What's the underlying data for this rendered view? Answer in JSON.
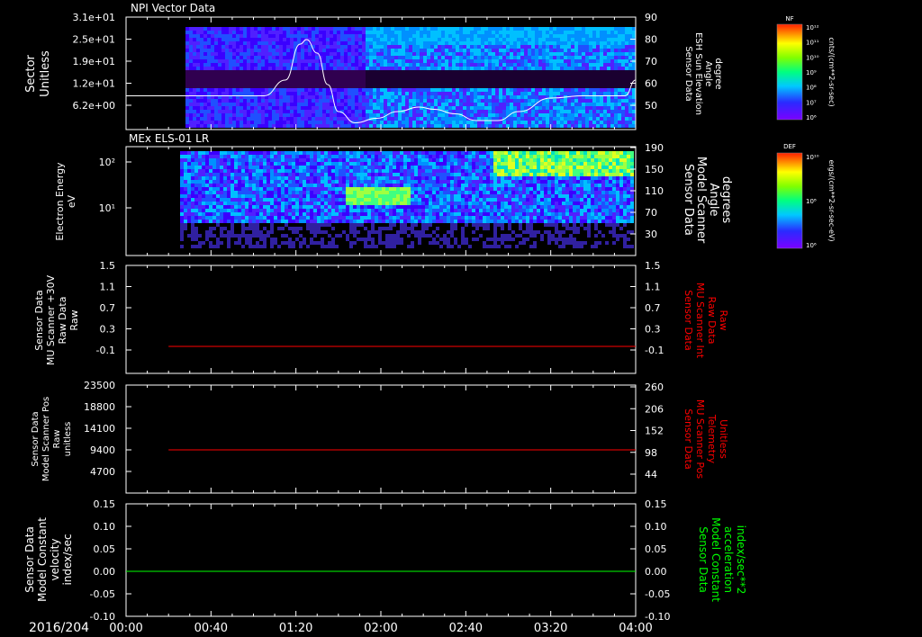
{
  "footer": {
    "date": "2016/204"
  },
  "time_ticks": [
    "00:00",
    "00:40",
    "01:20",
    "02:00",
    "02:40",
    "03:20",
    "04:00"
  ],
  "colorbars": [
    {
      "label": "NF",
      "unit": "cnts/(cm**2-sr-sec)",
      "ticks": [
        "10¹²",
        "10¹¹",
        "10¹⁰",
        "10⁹",
        "10⁸",
        "10⁷",
        "10⁶"
      ]
    },
    {
      "label": "DEF",
      "unit": "ergs/(cm**2-sr-sec-eV)",
      "ticks": [
        "10¹⁰",
        "10⁸",
        "10⁶"
      ]
    }
  ],
  "chart_data": [
    {
      "type": "heatmap",
      "title": "NPI Vector Data",
      "ylabel": [
        "Sector",
        "Unitless"
      ],
      "yticks": [
        "3.1e+01",
        "2.5e+01",
        "1.9e+01",
        "1.2e+01",
        "6.2e+00"
      ],
      "y2label": [
        "Sensor Data",
        "ESH Sun Elevation",
        "Angle",
        "degree"
      ],
      "y2ticks": [
        "90",
        "80",
        "70",
        "60",
        "50"
      ],
      "y2lim": [
        40,
        90
      ],
      "xlim": [
        0,
        240
      ],
      "overlay_series": {
        "name": "ESH Sun Elevation Angle",
        "color": "#ffffff",
        "x": [
          0,
          65,
          75,
          82,
          85,
          90,
          95,
          100,
          108,
          118,
          128,
          138,
          145,
          155,
          165,
          175,
          185,
          200,
          215,
          225,
          235,
          240
        ],
        "y": [
          55,
          55,
          62,
          78,
          80,
          74,
          60,
          48,
          43,
          45,
          48,
          50,
          49,
          47,
          44,
          44,
          48,
          54,
          55,
          55,
          55,
          62
        ]
      }
    },
    {
      "type": "heatmap",
      "title": "MEx ELS-01 LR",
      "ylabel": [
        "Electron Energy",
        "eV"
      ],
      "yticks": [
        "10²",
        "10¹"
      ],
      "y2label": [
        "Sensor Data",
        "Model Scanner",
        "Angle",
        "degrees"
      ],
      "y2ticks": [
        "190",
        "150",
        "110",
        "70",
        "30"
      ],
      "y2lim": [
        10,
        190
      ],
      "xlim": [
        0,
        240
      ],
      "overlay_series": {
        "name": "Model Scanner Angle",
        "color": "#ffffff",
        "x": [
          0,
          240
        ],
        "y": [
          10,
          10
        ]
      }
    },
    {
      "type": "line",
      "ylabel": [
        "Sensor Data",
        "MU Scanner +30V",
        "Raw Data",
        "Raw"
      ],
      "yticks": [
        "1.5",
        "1.1",
        "0.7",
        "0.3",
        "-0.1"
      ],
      "ylim": [
        -0.5,
        1.5
      ],
      "y2label": [
        "Sensor Data",
        "MU Scanner Int",
        "Raw Data",
        "Raw"
      ],
      "y2label_color": "#ff0000",
      "y2ticks": [
        "1.5",
        "1.1",
        "0.7",
        "0.3",
        "-0.1"
      ],
      "xlim": [
        0,
        240
      ],
      "series": [
        {
          "color": "#ff0000",
          "x": [
            20,
            240
          ],
          "y": [
            0.0,
            0.0
          ]
        }
      ]
    },
    {
      "type": "line",
      "ylabel": [
        "Sensor Data",
        "Model Scanner Pos",
        "Raw",
        "unitless"
      ],
      "yticks": [
        "23500",
        "18800",
        "14100",
        "9400",
        "4700"
      ],
      "ylim": [
        0,
        23500
      ],
      "y2label": [
        "Sensor Data",
        "MU Scanner Pos",
        "Telemetry",
        "Unitless"
      ],
      "y2label_color": "#ff0000",
      "y2ticks": [
        "260",
        "206",
        "152",
        "98",
        "44"
      ],
      "y2lim": [
        -10,
        260
      ],
      "xlim": [
        0,
        240
      ],
      "series": [
        {
          "color": "#ff0000",
          "x": [
            20,
            240
          ],
          "y": [
            9400,
            9400
          ]
        }
      ]
    },
    {
      "type": "line",
      "ylabel": [
        "Sensor Data",
        "Model Constant",
        "velocity",
        "index/sec"
      ],
      "yticks": [
        "0.15",
        "0.10",
        "0.05",
        "0.00",
        "-0.05",
        "-0.10"
      ],
      "ylim": [
        -0.1,
        0.15
      ],
      "y2label": [
        "Sensor Data",
        "Model Constant",
        "acceleration",
        "index/sec**2"
      ],
      "y2label_color": "#00ff00",
      "y2ticks": [
        "0.15",
        "0.10",
        "0.05",
        "0.00",
        "-0.05",
        "-0.10"
      ],
      "xlim": [
        0,
        240
      ],
      "series": [
        {
          "color": "#00ff00",
          "x": [
            0,
            240
          ],
          "y": [
            0.0,
            0.0
          ]
        }
      ]
    }
  ]
}
